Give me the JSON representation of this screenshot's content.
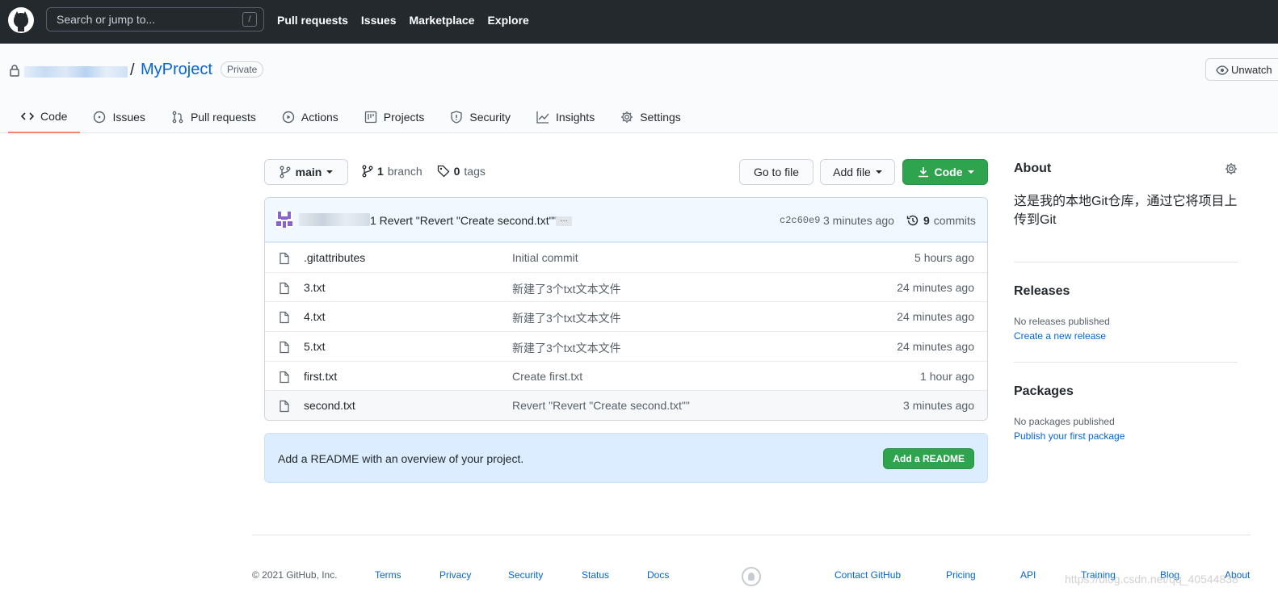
{
  "header": {
    "search_placeholder": "Search or jump to...",
    "search_shortcut": "/",
    "nav": [
      "Pull requests",
      "Issues",
      "Marketplace",
      "Explore"
    ]
  },
  "repo": {
    "separator": "/",
    "name": "MyProject",
    "visibility": "Private",
    "unwatch_label": "Unwatch"
  },
  "tabs": [
    {
      "label": "Code",
      "icon": "code-icon",
      "selected": true
    },
    {
      "label": "Issues",
      "icon": "issue-icon"
    },
    {
      "label": "Pull requests",
      "icon": "pull-request-icon"
    },
    {
      "label": "Actions",
      "icon": "play-icon"
    },
    {
      "label": "Projects",
      "icon": "project-icon"
    },
    {
      "label": "Security",
      "icon": "shield-icon"
    },
    {
      "label": "Insights",
      "icon": "graph-icon"
    },
    {
      "label": "Settings",
      "icon": "gear-icon"
    }
  ],
  "toolbar": {
    "branch": "main",
    "branch_count": "1",
    "branch_label": "branch",
    "tag_count": "0",
    "tag_label": "tags",
    "go_to_file": "Go to file",
    "add_file": "Add file",
    "code": "Code"
  },
  "latest_commit": {
    "message": "1 Revert \"Revert \"Create second.txt\"\"",
    "ellipsis": "…",
    "sha": "c2c60e9",
    "age": "3 minutes ago",
    "count": "9",
    "count_label": "commits"
  },
  "files": [
    {
      "name": ".gitattributes",
      "commit": "Initial commit",
      "age": "5 hours ago"
    },
    {
      "name": "3.txt",
      "commit": "新建了3个txt文本文件",
      "age": "24 minutes ago"
    },
    {
      "name": "4.txt",
      "commit": "新建了3个txt文本文件",
      "age": "24 minutes ago"
    },
    {
      "name": "5.txt",
      "commit": "新建了3个txt文本文件",
      "age": "24 minutes ago"
    },
    {
      "name": "first.txt",
      "commit": "Create first.txt",
      "age": "1 hour ago"
    },
    {
      "name": "second.txt",
      "commit": "Revert \"Revert \"Create second.txt\"\"",
      "age": "3 minutes ago"
    }
  ],
  "readme": {
    "text": "Add a README with an overview of your project.",
    "button": "Add a README"
  },
  "sidebar": {
    "about_title": "About",
    "about_desc": "这是我的本地Git仓库，通过它将项目上传到Git",
    "releases_title": "Releases",
    "releases_none": "No releases published",
    "releases_link": "Create a new release",
    "packages_title": "Packages",
    "packages_none": "No packages published",
    "packages_link": "Publish your first package"
  },
  "footer": {
    "copyright": "© 2021 GitHub, Inc.",
    "links_left": [
      "Terms",
      "Privacy",
      "Security",
      "Status",
      "Docs"
    ],
    "links_right": [
      "Contact GitHub",
      "Pricing",
      "API",
      "Training",
      "Blog",
      "About"
    ]
  },
  "watermark": "https://blog.csdn.net/qq_40544838",
  "colors": {
    "header_bg": "#24292e",
    "link": "#0366d6",
    "green": "#2ea44f",
    "tab_underline": "#f9826c"
  }
}
